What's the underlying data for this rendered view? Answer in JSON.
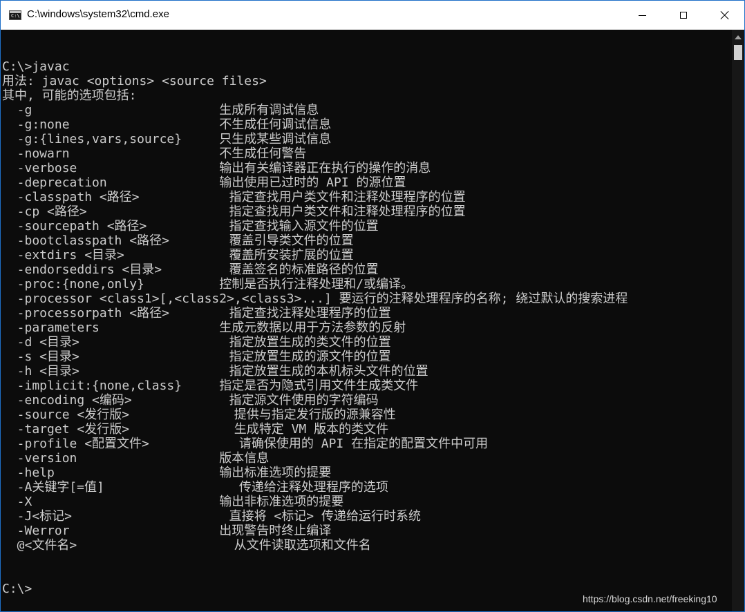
{
  "window": {
    "title": "C:\\windows\\system32\\cmd.exe",
    "icon": "cmd-icon",
    "controls": [
      "minimize-icon",
      "maximize-icon",
      "close-icon"
    ]
  },
  "colors": {
    "console_bg": "#0c0c0c",
    "console_text": "#cccccc",
    "titlebar_bg": "#ffffff",
    "window_border": "#1e6fc7"
  },
  "console": {
    "lines": [
      "",
      "C:\\>javac",
      "用法: javac <options> <source files>",
      "其中, 可能的选项包括:",
      "  -g                         生成所有调试信息",
      "  -g:none                    不生成任何调试信息",
      "  -g:{lines,vars,source}     只生成某些调试信息",
      "  -nowarn                    不生成任何警告",
      "  -verbose                   输出有关编译器正在执行的操作的消息",
      "  -deprecation               输出使用已过时的 API 的源位置",
      "  -classpath <路径>            指定查找用户类文件和注释处理程序的位置",
      "  -cp <路径>                   指定查找用户类文件和注释处理程序的位置",
      "  -sourcepath <路径>           指定查找输入源文件的位置",
      "  -bootclasspath <路径>        覆盖引导类文件的位置",
      "  -extdirs <目录>              覆盖所安装扩展的位置",
      "  -endorseddirs <目录>         覆盖签名的标准路径的位置",
      "  -proc:{none,only}          控制是否执行注释处理和/或编译。",
      "  -processor <class1>[,<class2>,<class3>...] 要运行的注释处理程序的名称; 绕过默认的搜索进程",
      "  -processorpath <路径>        指定查找注释处理程序的位置",
      "  -parameters                生成元数据以用于方法参数的反射",
      "  -d <目录>                    指定放置生成的类文件的位置",
      "  -s <目录>                    指定放置生成的源文件的位置",
      "  -h <目录>                    指定放置生成的本机标头文件的位置",
      "  -implicit:{none,class}     指定是否为隐式引用文件生成类文件",
      "  -encoding <编码>             指定源文件使用的字符编码",
      "  -source <发行版>              提供与指定发行版的源兼容性",
      "  -target <发行版>              生成特定 VM 版本的类文件",
      "  -profile <配置文件>            请确保使用的 API 在指定的配置文件中可用",
      "  -version                   版本信息",
      "  -help                      输出标准选项的提要",
      "  -A关键字[=值]                  传递给注释处理程序的选项",
      "  -X                         输出非标准选项的提要",
      "  -J<标记>                     直接将 <标记> 传递给运行时系统",
      "  -Werror                    出现警告时终止编译",
      "  @<文件名>                     从文件读取选项和文件名",
      "",
      "",
      "C:\\>"
    ]
  },
  "watermark": "https://blog.csdn.net/freeking10"
}
